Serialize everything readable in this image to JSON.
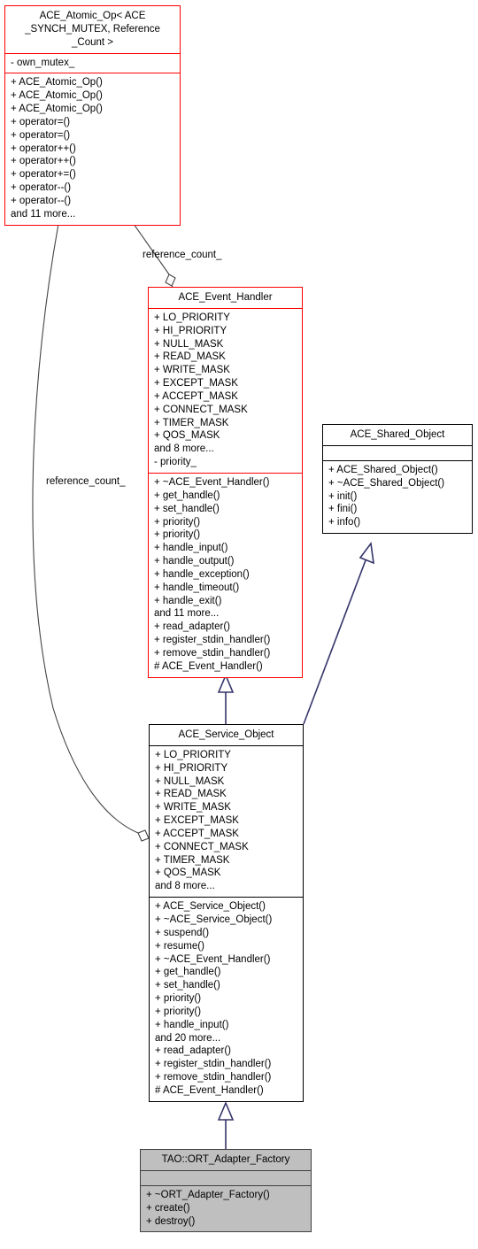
{
  "diagram": {
    "type": "uml-class-diagram",
    "background": "#ffffff",
    "colors": {
      "highlight_border": "#ff0000",
      "normal_border": "#000000",
      "inheritance_edge": "#35356b",
      "aggregation_edge": "#444444",
      "node_fill": "#bfbfbf"
    }
  },
  "classes": {
    "atomic_op": {
      "name": "ACE_Atomic_Op< ACE\n_SYNCH_MUTEX, Reference\n_Count >",
      "attributes": [
        "- own_mutex_"
      ],
      "operations": [
        "+ ACE_Atomic_Op()",
        "+ ACE_Atomic_Op()",
        "+ ACE_Atomic_Op()",
        "+ operator=()",
        "+ operator=()",
        "+ operator++()",
        "+ operator++()",
        "+ operator+=()",
        "+ operator--()",
        "+ operator--()",
        "and 11 more..."
      ]
    },
    "event_handler": {
      "name": "ACE_Event_Handler",
      "attributes": [
        "+ LO_PRIORITY",
        "+ HI_PRIORITY",
        "+ NULL_MASK",
        "+ READ_MASK",
        "+ WRITE_MASK",
        "+ EXCEPT_MASK",
        "+ ACCEPT_MASK",
        "+ CONNECT_MASK",
        "+ TIMER_MASK",
        "+ QOS_MASK",
        "and 8 more...",
        "- priority_"
      ],
      "operations": [
        "+ ~ACE_Event_Handler()",
        "+ get_handle()",
        "+ set_handle()",
        "+ priority()",
        "+ priority()",
        "+ handle_input()",
        "+ handle_output()",
        "+ handle_exception()",
        "+ handle_timeout()",
        "+ handle_exit()",
        "and 11 more...",
        "+ read_adapter()",
        "+ register_stdin_handler()",
        "+ remove_stdin_handler()",
        "# ACE_Event_Handler()"
      ]
    },
    "shared_object": {
      "name": "ACE_Shared_Object",
      "attributes": [],
      "operations": [
        "+ ACE_Shared_Object()",
        "+ ~ACE_Shared_Object()",
        "+ init()",
        "+ fini()",
        "+ info()"
      ]
    },
    "service_object": {
      "name": "ACE_Service_Object",
      "attributes": [
        "+ LO_PRIORITY",
        "+ HI_PRIORITY",
        "+ NULL_MASK",
        "+ READ_MASK",
        "+ WRITE_MASK",
        "+ EXCEPT_MASK",
        "+ ACCEPT_MASK",
        "+ CONNECT_MASK",
        "+ TIMER_MASK",
        "+ QOS_MASK",
        "and 8 more..."
      ],
      "operations": [
        "+ ACE_Service_Object()",
        "+ ~ACE_Service_Object()",
        "+ suspend()",
        "+ resume()",
        "+ ~ACE_Event_Handler()",
        "+ get_handle()",
        "+ set_handle()",
        "+ priority()",
        "+ priority()",
        "+ handle_input()",
        "and 20 more...",
        "+ read_adapter()",
        "+ register_stdin_handler()",
        "+ remove_stdin_handler()",
        "# ACE_Event_Handler()"
      ]
    },
    "ort_adapter_factory": {
      "name": "TAO::ORT_Adapter_Factory",
      "attributes": [],
      "operations": [
        "+ ~ORT_Adapter_Factory()",
        "+ create()",
        "+ destroy()"
      ]
    }
  },
  "edge_labels": {
    "ref_count_top": "reference_count_",
    "ref_count_left": "reference_count_"
  }
}
